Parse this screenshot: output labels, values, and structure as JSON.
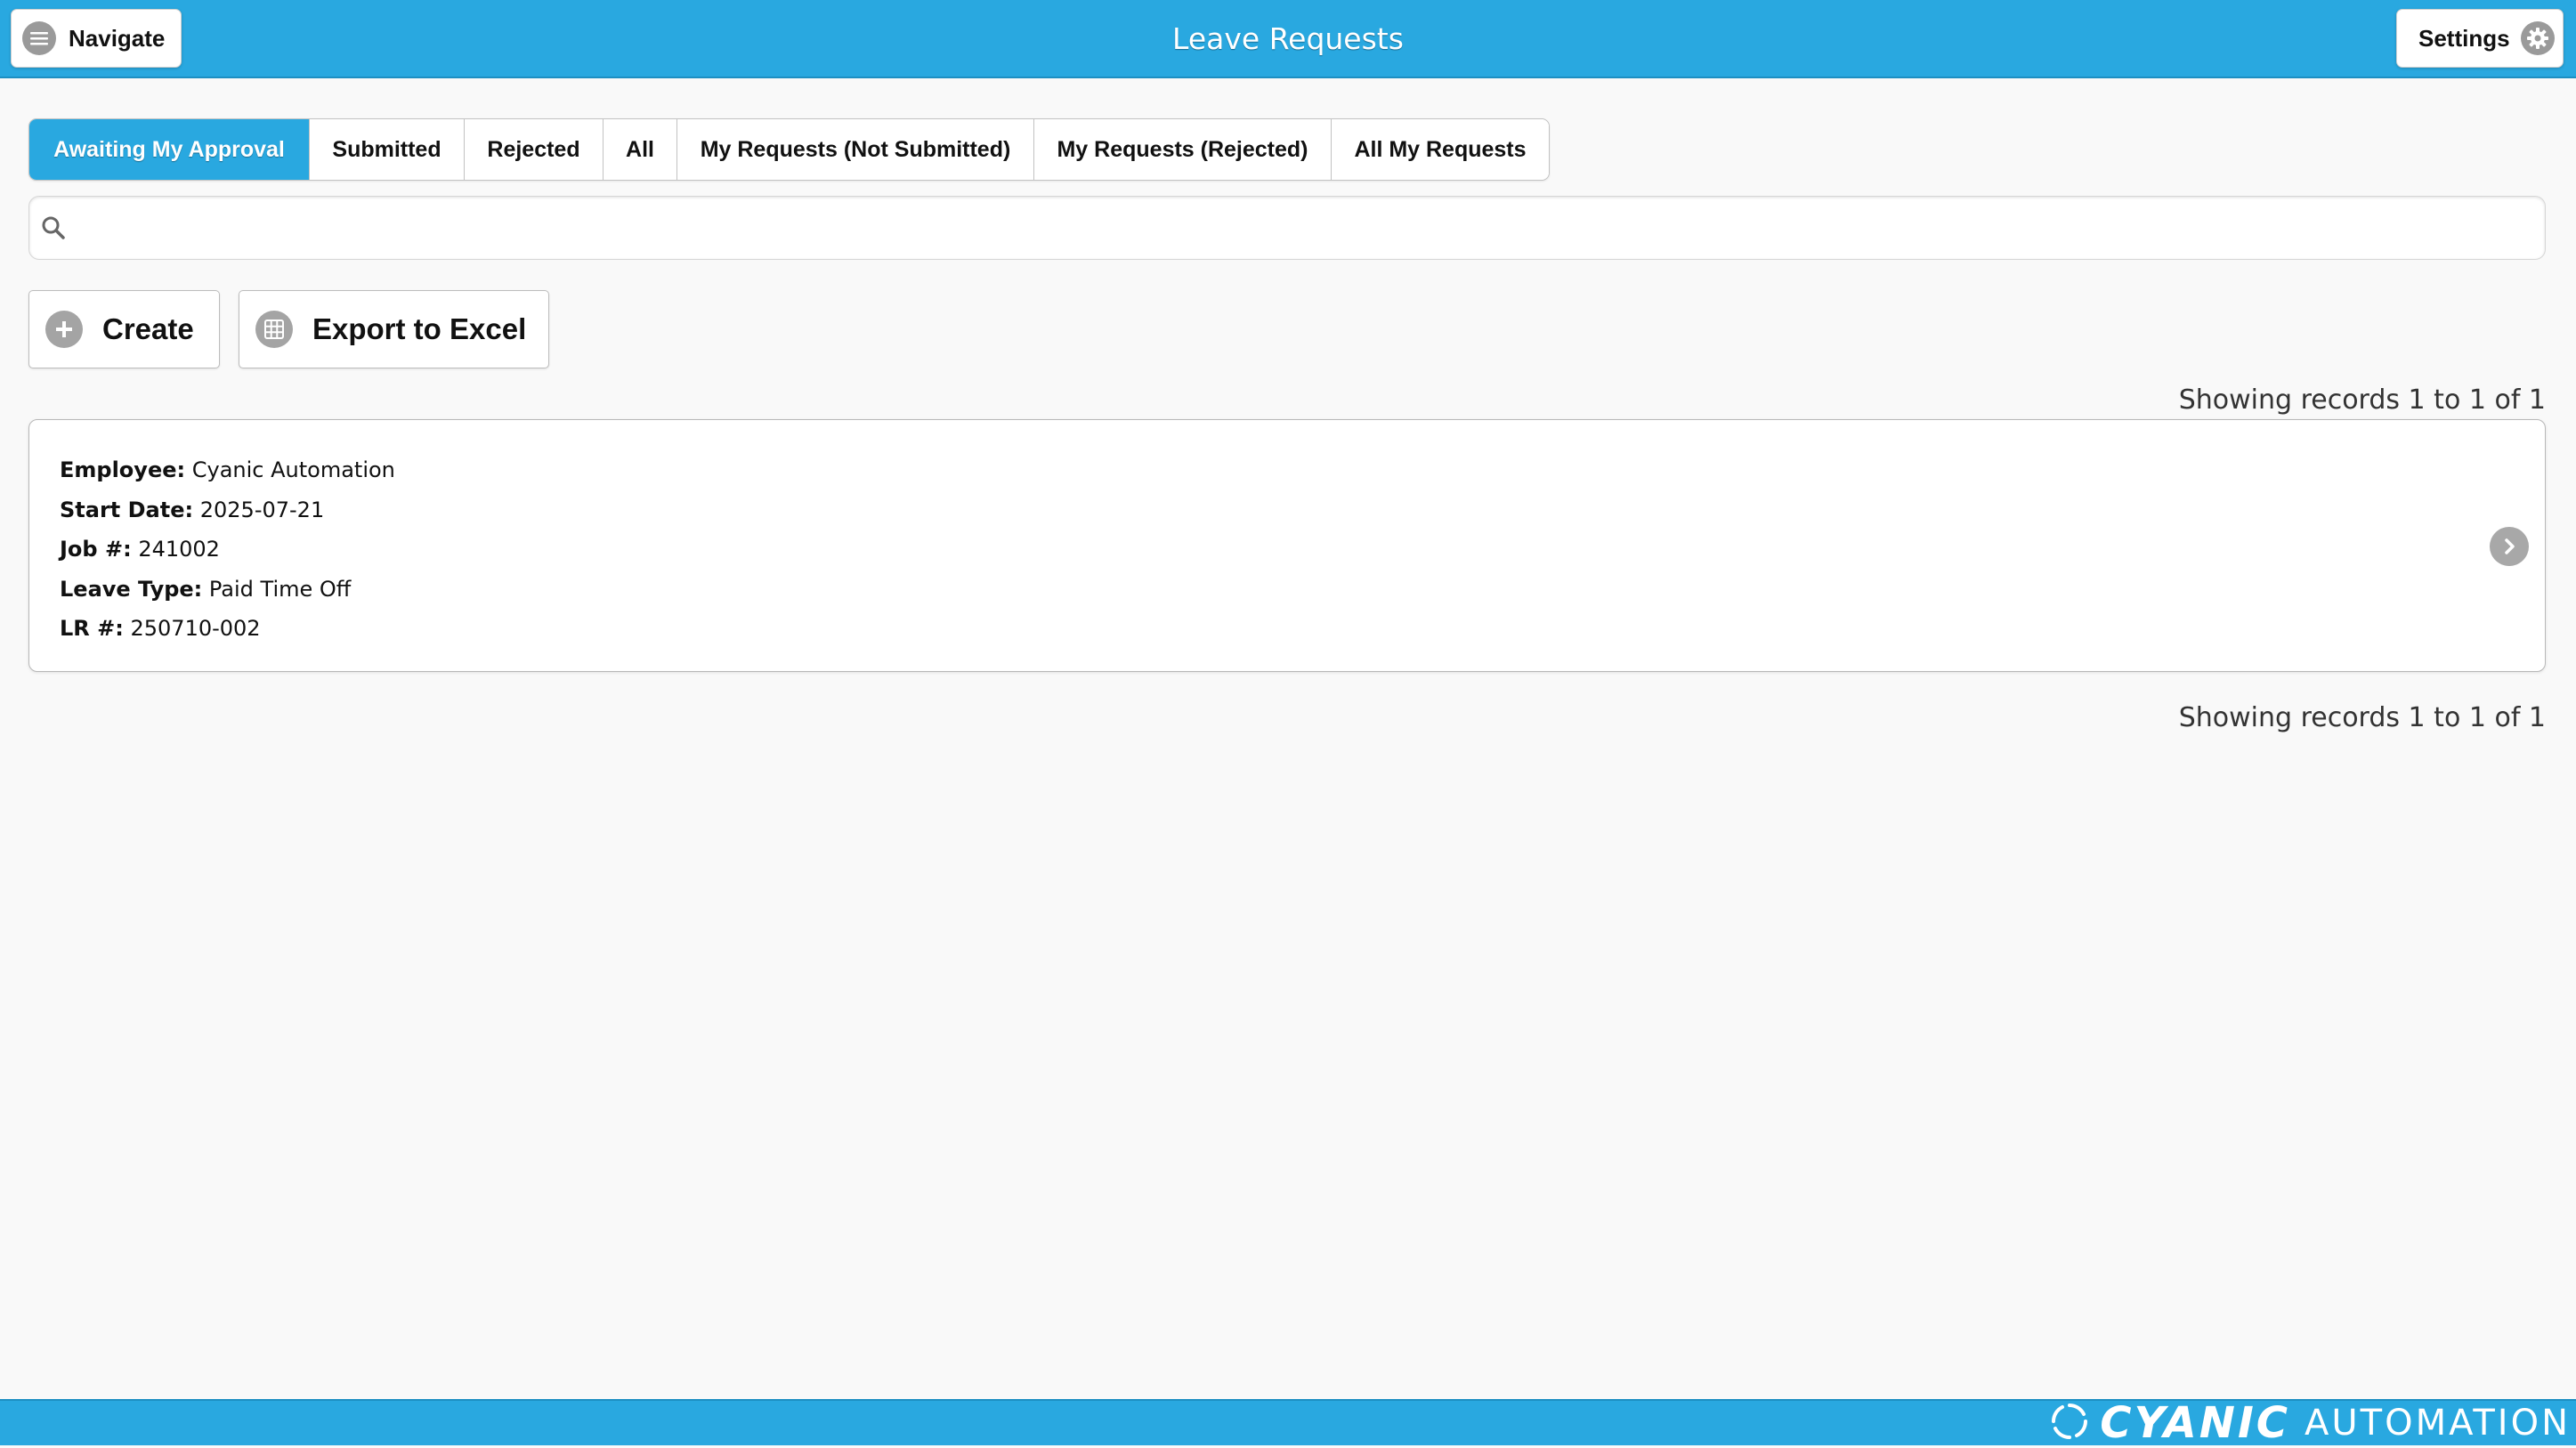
{
  "header": {
    "title": "Leave Requests",
    "navigate_label": "Navigate",
    "settings_label": "Settings"
  },
  "tabs": [
    {
      "label": "Awaiting My Approval",
      "active": true
    },
    {
      "label": "Submitted",
      "active": false
    },
    {
      "label": "Rejected",
      "active": false
    },
    {
      "label": "All",
      "active": false
    },
    {
      "label": "My Requests (Not Submitted)",
      "active": false
    },
    {
      "label": "My Requests (Rejected)",
      "active": false
    },
    {
      "label": "All My Requests",
      "active": false
    }
  ],
  "search": {
    "value": "",
    "placeholder": ""
  },
  "actions": {
    "create_label": "Create",
    "export_label": "Export to Excel"
  },
  "records_info": "Showing records 1 to 1 of 1",
  "records": [
    {
      "fields": [
        {
          "label": "Employee:",
          "value": "Cyanic Automation"
        },
        {
          "label": "Start Date:",
          "value": "2025-07-21"
        },
        {
          "label": "Job #:",
          "value": "241002"
        },
        {
          "label": "Leave Type:",
          "value": "Paid Time Off"
        },
        {
          "label": "LR #:",
          "value": "250710-002"
        }
      ]
    }
  ],
  "footer": {
    "brand_part1": "CYANIC",
    "brand_part2": "AUTOMATION"
  },
  "colors": {
    "accent": "#29a8e0",
    "background": "#f9f9f9",
    "icon_gray": "#9a9a9a"
  },
  "icons": [
    "hamburger-icon",
    "gear-icon",
    "search-icon",
    "plus-icon",
    "grid-icon",
    "chevron-right-icon",
    "brand-logo-icon"
  ]
}
